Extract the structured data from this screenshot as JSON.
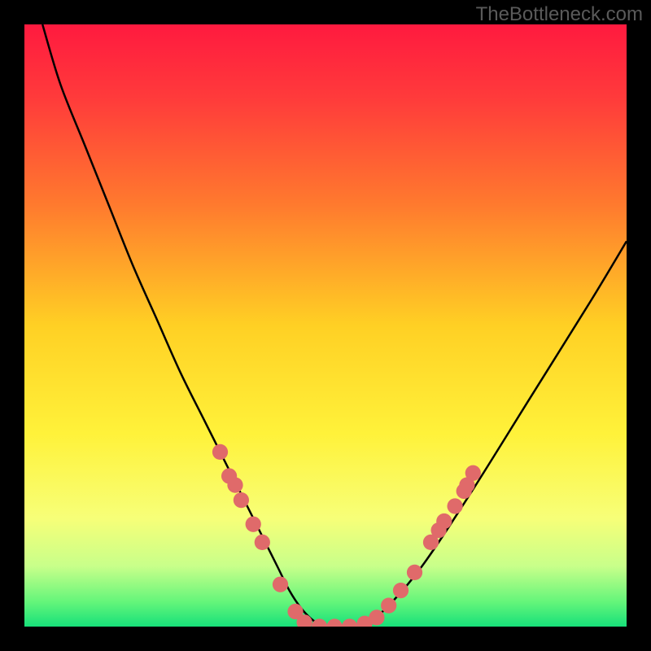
{
  "watermark": "TheBottleneck.com",
  "chart_data": {
    "type": "line",
    "title": "",
    "xlabel": "",
    "ylabel": "",
    "xlim": [
      0,
      100
    ],
    "ylim": [
      0,
      100
    ],
    "background_gradient_stops": [
      {
        "offset": 0.0,
        "color": "#ff1a3f"
      },
      {
        "offset": 0.12,
        "color": "#ff3a3b"
      },
      {
        "offset": 0.3,
        "color": "#ff7a2e"
      },
      {
        "offset": 0.5,
        "color": "#ffd024"
      },
      {
        "offset": 0.68,
        "color": "#fff23a"
      },
      {
        "offset": 0.82,
        "color": "#f7ff78"
      },
      {
        "offset": 0.9,
        "color": "#c8ff8a"
      },
      {
        "offset": 0.96,
        "color": "#62f57a"
      },
      {
        "offset": 1.0,
        "color": "#17e07a"
      }
    ],
    "series": [
      {
        "name": "bottleneck-curve",
        "color": "#000000",
        "x": [
          3,
          6,
          10,
          14,
          18,
          22,
          26,
          30,
          34,
          36,
          38,
          40,
          42,
          44,
          46,
          48,
          50,
          52,
          56,
          60,
          66,
          74,
          84,
          94,
          100
        ],
        "y": [
          100,
          90,
          80,
          70,
          60,
          51,
          42,
          34,
          26,
          22,
          18,
          14,
          10,
          6,
          3,
          1,
          0,
          0,
          0,
          3,
          10,
          22,
          38,
          54,
          64
        ]
      }
    ],
    "markers": {
      "name": "sample-points",
      "color": "#e06a6a",
      "radius_frac": 0.013,
      "points": [
        {
          "x": 32.5,
          "y": 29
        },
        {
          "x": 34.0,
          "y": 25
        },
        {
          "x": 35.0,
          "y": 23.5
        },
        {
          "x": 36.0,
          "y": 21
        },
        {
          "x": 38.0,
          "y": 17
        },
        {
          "x": 39.5,
          "y": 14
        },
        {
          "x": 42.5,
          "y": 7
        },
        {
          "x": 45.0,
          "y": 2.5
        },
        {
          "x": 46.5,
          "y": 0.7
        },
        {
          "x": 49.0,
          "y": 0
        },
        {
          "x": 51.5,
          "y": 0
        },
        {
          "x": 54.0,
          "y": 0
        },
        {
          "x": 56.5,
          "y": 0.5
        },
        {
          "x": 58.5,
          "y": 1.5
        },
        {
          "x": 60.5,
          "y": 3.5
        },
        {
          "x": 62.5,
          "y": 6
        },
        {
          "x": 64.8,
          "y": 9
        },
        {
          "x": 67.5,
          "y": 14
        },
        {
          "x": 68.8,
          "y": 16
        },
        {
          "x": 69.7,
          "y": 17.5
        },
        {
          "x": 71.5,
          "y": 20
        },
        {
          "x": 73.0,
          "y": 22.5
        },
        {
          "x": 73.5,
          "y": 23.5
        },
        {
          "x": 74.5,
          "y": 25.5
        }
      ]
    }
  }
}
